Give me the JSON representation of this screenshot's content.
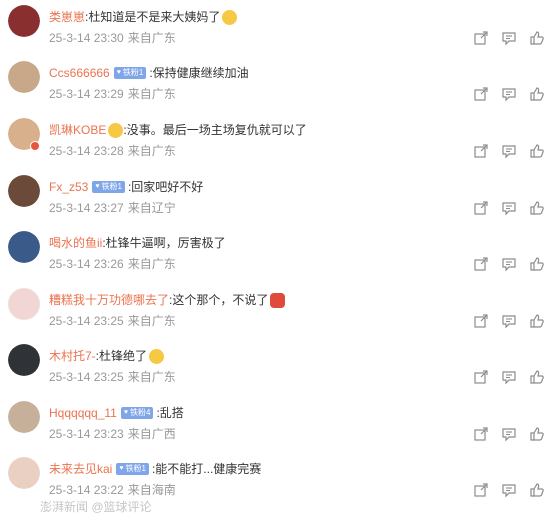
{
  "comments": [
    {
      "user": "类崽崽",
      "fan": "",
      "text": ":杜知道是不是来大姨妈了",
      "emoji": "smile",
      "time": "25-3-14 23:30",
      "loc": "来自广东",
      "avatarColor": "#8a2f2f",
      "verified": false
    },
    {
      "user": "Ccs666666",
      "fan": "铁粉1",
      "text": ":保持健康继续加油",
      "emoji": "",
      "time": "25-3-14 23:29",
      "loc": "来自广东",
      "avatarColor": "#c9a88a",
      "verified": false
    },
    {
      "user": "凯琳KOBE",
      "fan": "",
      "text": ":没事。最后一场主场复仇就可以了",
      "emoji": "smile-before",
      "time": "25-3-14 23:28",
      "loc": "来自广东",
      "avatarColor": "#d8b08b",
      "verified": true
    },
    {
      "user": "Fx_z53",
      "fan": "铁粉1",
      "text": ":回家吧好不好",
      "emoji": "",
      "time": "25-3-14 23:27",
      "loc": "来自辽宁",
      "avatarColor": "#6b4a3a",
      "verified": false
    },
    {
      "user": "喝水的鱼ii",
      "fan": "",
      "text": ":杜锋牛逼啊，厉害极了",
      "emoji": "",
      "time": "25-3-14 23:26",
      "loc": "来自广东",
      "avatarColor": "#3a5a8a",
      "verified": false
    },
    {
      "user": "糟糕我十万功德哪去了",
      "fan": "",
      "text": ":这个那个，不说了",
      "emoji": "crab",
      "time": "25-3-14 23:25",
      "loc": "来自广东",
      "avatarColor": "#f2d6d6",
      "verified": false
    },
    {
      "user": "木村托7-",
      "fan": "",
      "text": ":杜锋绝了",
      "emoji": "thumb",
      "time": "25-3-14 23:25",
      "loc": "来自广东",
      "avatarColor": "#2f3236",
      "verified": false
    },
    {
      "user": "Hqqqqqq_11",
      "fan": "铁粉4",
      "text": ":乱搭",
      "emoji": "",
      "time": "25-3-14 23:23",
      "loc": "来自广西",
      "avatarColor": "#c7b09a",
      "verified": false
    },
    {
      "user": "未来去见kai",
      "fan": "铁粉1",
      "text": ":能不能打...健康完赛",
      "emoji": "",
      "time": "25-3-14 23:22",
      "loc": "来自海南",
      "avatarColor": "#e9d0c2",
      "verified": false
    }
  ],
  "watermark": "澎湃新闻 @篮球评论"
}
